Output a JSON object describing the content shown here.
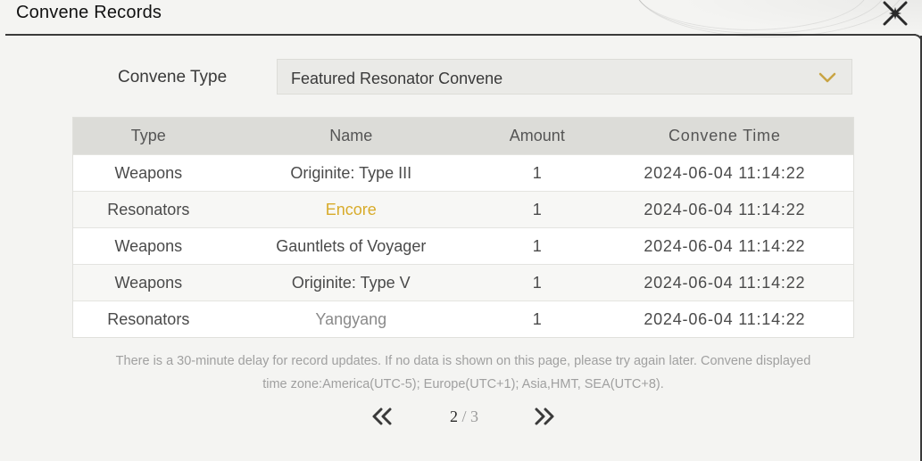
{
  "header": {
    "title": "Convene Records",
    "close_icon": "close-star-icon"
  },
  "filter": {
    "label": "Convene Type",
    "selected": "Featured Resonator Convene",
    "dropdown_icon": "chevron-down-icon"
  },
  "table": {
    "columns": [
      "Type",
      "Name",
      "Amount",
      "Convene Time"
    ],
    "rows": [
      {
        "type": "Weapons",
        "name": "Originite: Type III",
        "amount": "1",
        "time": "2024-06-04 11:14:22",
        "name_color": "#4a4a4a"
      },
      {
        "type": "Resonators",
        "name": "Encore",
        "amount": "1",
        "time": "2024-06-04 11:14:22",
        "name_color": "#d8ab2a"
      },
      {
        "type": "Weapons",
        "name": "Gauntlets of Voyager",
        "amount": "1",
        "time": "2024-06-04 11:14:22",
        "name_color": "#4a4a4a"
      },
      {
        "type": "Weapons",
        "name": "Originite: Type V",
        "amount": "1",
        "time": "2024-06-04 11:14:22",
        "name_color": "#4a4a4a"
      },
      {
        "type": "Resonators",
        "name": "Yangyang",
        "amount": "1",
        "time": "2024-06-04 11:14:22",
        "name_color": "#8a8a8a"
      }
    ]
  },
  "notice": {
    "line1": "There is a 30-minute delay for record updates. If no data is shown on this page, please try again later. Convene displayed",
    "line2": "time zone:America(UTC-5); Europe(UTC+1); Asia,HMT, SEA(UTC+8)."
  },
  "pagination": {
    "current": "2",
    "separator": "/",
    "total": "3",
    "prev_icon": "double-chevron-left-icon",
    "next_icon": "double-chevron-right-icon"
  }
}
